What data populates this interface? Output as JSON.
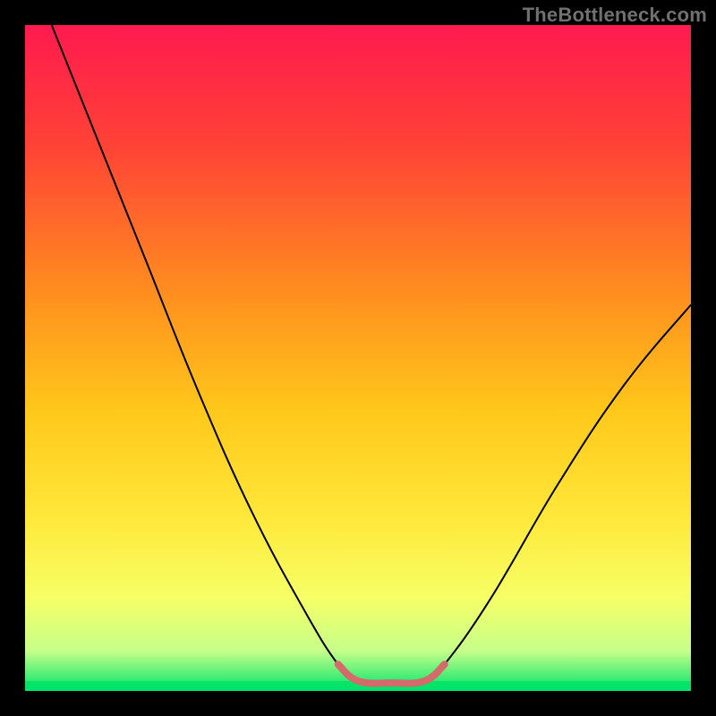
{
  "attribution": "TheBottleneck.com",
  "chart_data": {
    "type": "line",
    "title": "",
    "xlabel": "",
    "ylabel": "",
    "xlim": [
      0,
      100
    ],
    "ylim": [
      0,
      100
    ],
    "background": {
      "kind": "vertical-gradient",
      "stops": [
        {
          "offset": 0.0,
          "color": "#ff1a4f"
        },
        {
          "offset": 0.18,
          "color": "#ff4236"
        },
        {
          "offset": 0.4,
          "color": "#ff8d1f"
        },
        {
          "offset": 0.58,
          "color": "#ffc81a"
        },
        {
          "offset": 0.74,
          "color": "#ffe83a"
        },
        {
          "offset": 0.86,
          "color": "#f6ff66"
        },
        {
          "offset": 0.94,
          "color": "#c6ff8a"
        },
        {
          "offset": 1.0,
          "color": "#00e46a"
        }
      ]
    },
    "series": [
      {
        "name": "curve",
        "color": "#000000",
        "width": 2,
        "points": [
          {
            "x": 4,
            "y": 100
          },
          {
            "x": 10,
            "y": 85
          },
          {
            "x": 18,
            "y": 65
          },
          {
            "x": 26,
            "y": 45
          },
          {
            "x": 34,
            "y": 27
          },
          {
            "x": 42,
            "y": 12
          },
          {
            "x": 47,
            "y": 4
          },
          {
            "x": 50,
            "y": 1.5
          },
          {
            "x": 55,
            "y": 1.2
          },
          {
            "x": 60,
            "y": 1.5
          },
          {
            "x": 63,
            "y": 4
          },
          {
            "x": 70,
            "y": 14
          },
          {
            "x": 80,
            "y": 31
          },
          {
            "x": 90,
            "y": 46
          },
          {
            "x": 100,
            "y": 58
          }
        ]
      },
      {
        "name": "bottom-marker",
        "color": "#d46a6a",
        "width": 8,
        "points": [
          {
            "x": 47,
            "y": 4
          },
          {
            "x": 50,
            "y": 1.5
          },
          {
            "x": 55,
            "y": 1.2
          },
          {
            "x": 60,
            "y": 1.5
          },
          {
            "x": 63,
            "y": 4
          }
        ]
      }
    ]
  }
}
